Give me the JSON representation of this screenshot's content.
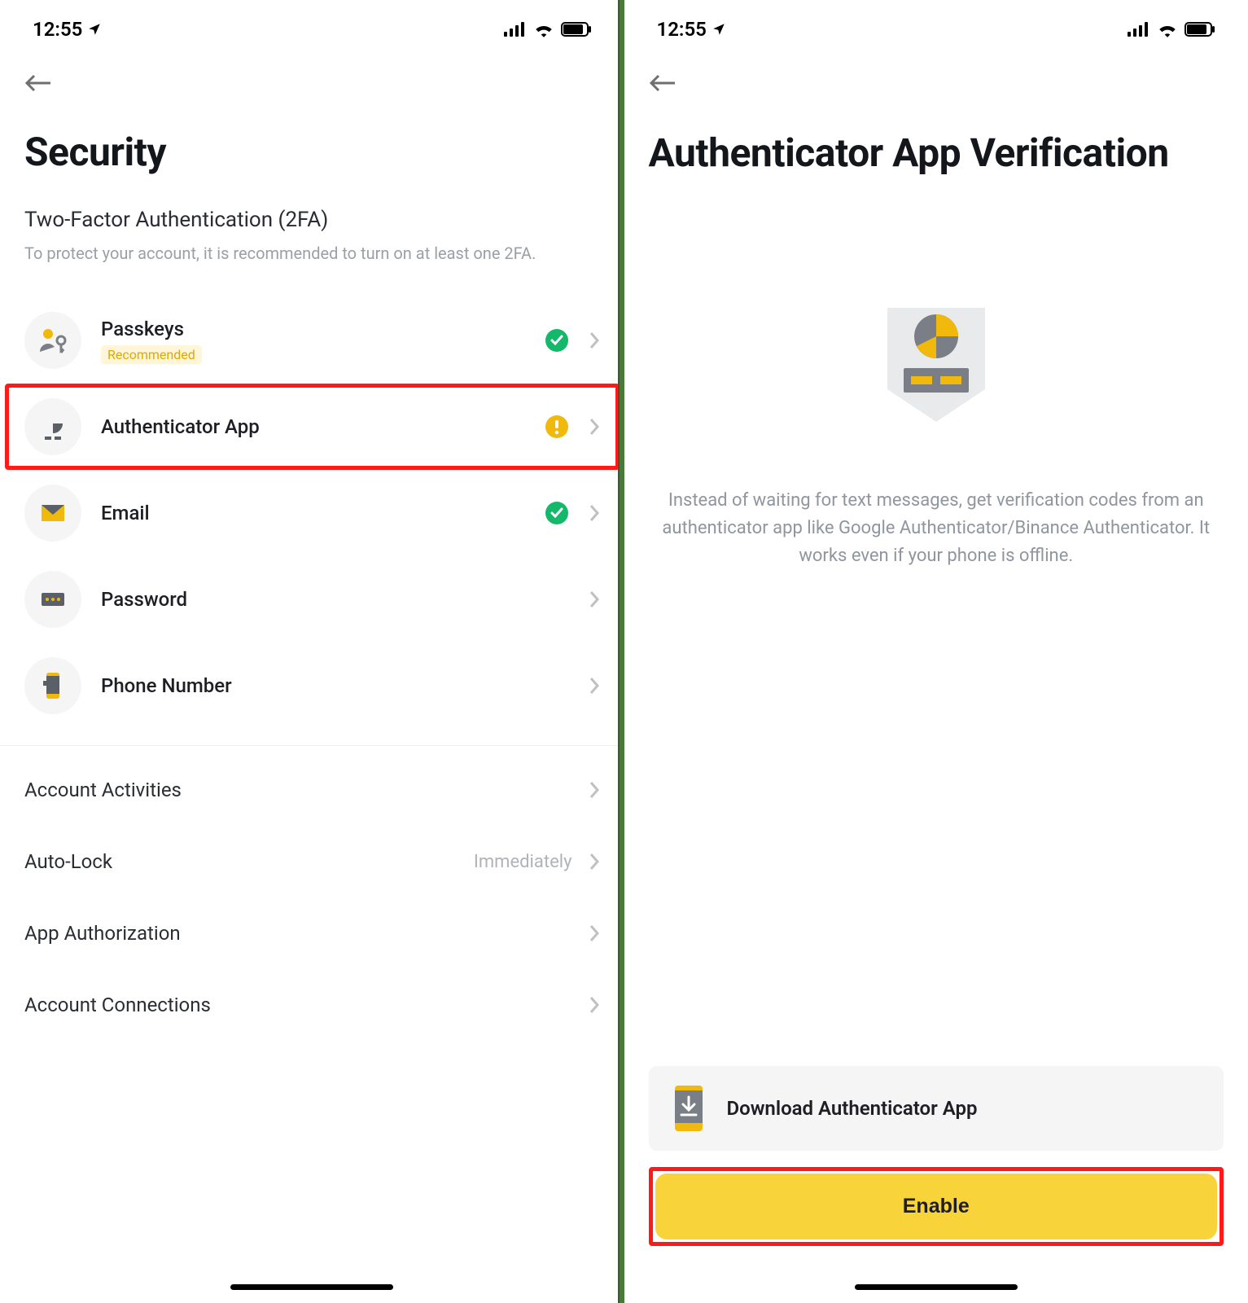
{
  "status": {
    "time": "12:55"
  },
  "screen1": {
    "title": "Security",
    "twofa_heading": "Two-Factor Authentication (2FA)",
    "twofa_desc": "To protect your account, it is recommended to turn on at least one 2FA.",
    "items": [
      {
        "label": "Passkeys",
        "badge": "Recommended",
        "status": "check"
      },
      {
        "label": "Authenticator App",
        "status": "warn",
        "highlight": true
      },
      {
        "label": "Email",
        "status": "check"
      },
      {
        "label": "Password"
      },
      {
        "label": "Phone Number"
      }
    ],
    "settings": [
      {
        "label": "Account Activities"
      },
      {
        "label": "Auto-Lock",
        "value": "Immediately"
      },
      {
        "label": "App Authorization"
      },
      {
        "label": "Account Connections"
      }
    ]
  },
  "screen2": {
    "title": "Authenticator App Verification",
    "info": "Instead of waiting for text messages, get verification codes from an authenticator app like Google Authenticator/Binance Authenticator. It works even if your phone is offline.",
    "download_label": "Download Authenticator App",
    "enable_label": "Enable"
  }
}
